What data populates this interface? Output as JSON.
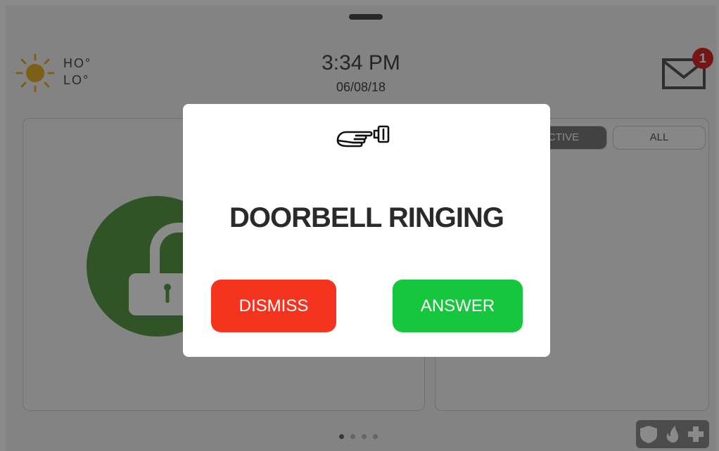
{
  "weather": {
    "icon": "sun-icon",
    "high": "HO°",
    "low": "LO°",
    "sun_color": "#e8b22c"
  },
  "clock": {
    "time": "3:34 PM",
    "date": "06/08/18"
  },
  "messages": {
    "icon": "envelope-icon",
    "badge_count": "1"
  },
  "sensor_filters": {
    "active_label": "ACTIVE",
    "all_label": "ALL"
  },
  "security_panel": {
    "state": "disarmed",
    "icon": "unlocked-padlock-icon",
    "accent_color": "#5a9b47"
  },
  "pager": {
    "total_pages": 4,
    "current_page": 1
  },
  "panic": {
    "icons": [
      "shield-icon",
      "fire-icon",
      "medical-cross-icon"
    ]
  },
  "modal": {
    "icon": "doorbell-icon",
    "title": "DOORBELL RINGING",
    "dismiss_label": "DISMISS",
    "answer_label": "ANSWER",
    "dismiss_color": "#f5341f",
    "answer_color": "#16c73d"
  }
}
